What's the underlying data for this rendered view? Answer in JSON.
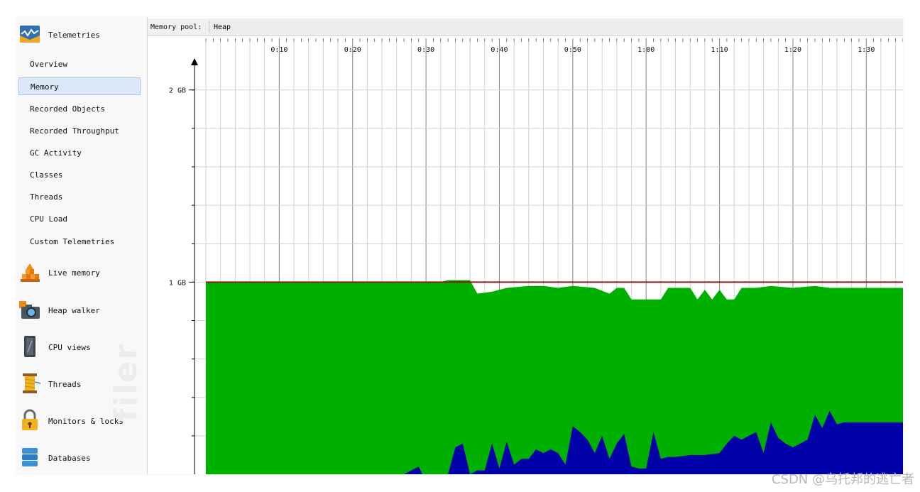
{
  "sidebar": {
    "telemetries": {
      "label": "Telemetries",
      "icon": "telemetries-icon",
      "items": [
        {
          "label": "Overview"
        },
        {
          "label": "Memory",
          "selected": true
        },
        {
          "label": "Recorded Objects"
        },
        {
          "label": "Recorded Throughput"
        },
        {
          "label": "GC Activity"
        },
        {
          "label": "Classes"
        },
        {
          "label": "Threads"
        },
        {
          "label": "CPU Load"
        },
        {
          "label": "Custom Telemetries"
        }
      ]
    },
    "sections": [
      {
        "label": "Live memory",
        "icon": "live-memory-icon"
      },
      {
        "label": "Heap walker",
        "icon": "camera-icon"
      },
      {
        "label": "CPU views",
        "icon": "cpu-views-icon"
      },
      {
        "label": "Threads",
        "icon": "thread-spool-icon"
      },
      {
        "label": "Monitors & locks",
        "icon": "lock-icon"
      },
      {
        "label": "Databases",
        "icon": "database-icon"
      }
    ],
    "watermark": "filer"
  },
  "toolbar": {
    "pool_label": "Memory pool:",
    "pool_value": "Heap"
  },
  "chart_data": {
    "type": "area",
    "x_ticks": [
      "0:10",
      "0:20",
      "0:30",
      "0:40",
      "0:50",
      "1:00",
      "1:10",
      "1:20",
      "1:30"
    ],
    "y_ticks": [
      "2 GB",
      "1 GB"
    ],
    "xlim_seconds": [
      0,
      95
    ],
    "ylim_gb": [
      0,
      2.18
    ],
    "grid": true,
    "max_line": {
      "value_gb": 1.0,
      "color": "#8b1a1a"
    },
    "series": [
      {
        "color": "#00b000",
        "x": [
          0,
          32,
          33,
          36,
          37,
          39,
          41,
          44,
          46,
          48,
          50,
          53,
          55,
          56,
          57,
          58,
          59,
          60,
          61,
          62,
          63,
          66,
          67,
          68,
          69,
          70,
          71,
          72,
          73,
          74,
          75,
          77,
          80,
          83,
          85,
          95
        ],
        "y": [
          1.0,
          1.0,
          1.01,
          1.01,
          0.94,
          0.95,
          0.97,
          0.98,
          0.98,
          0.97,
          0.98,
          0.97,
          0.94,
          0.97,
          0.97,
          0.91,
          0.91,
          0.91,
          0.91,
          0.91,
          0.97,
          0.97,
          0.91,
          0.96,
          0.91,
          0.96,
          0.91,
          0.91,
          0.97,
          0.97,
          0.97,
          0.98,
          0.97,
          0.98,
          0.97,
          0.97
        ]
      },
      {
        "color": "#0000a8",
        "x": [
          0,
          27,
          29,
          29.5,
          33,
          34,
          35,
          36,
          37,
          38,
          39,
          40,
          41,
          42,
          43,
          44,
          45,
          46,
          47,
          48,
          49,
          50,
          51,
          52,
          53,
          54,
          55,
          56,
          57,
          58,
          59,
          60,
          61,
          62,
          63,
          64,
          66,
          68,
          70,
          71,
          72,
          73,
          74,
          75,
          76,
          77,
          78,
          79,
          80,
          81,
          82,
          83,
          84,
          85,
          86,
          87,
          95
        ],
        "y": [
          0.0,
          0.0,
          0.04,
          0.0,
          0.0,
          0.14,
          0.16,
          0.0,
          0.02,
          0.02,
          0.16,
          0.03,
          0.17,
          0.05,
          0.08,
          0.08,
          0.13,
          0.11,
          0.13,
          0.11,
          0.05,
          0.25,
          0.22,
          0.18,
          0.11,
          0.2,
          0.08,
          0.16,
          0.21,
          0.04,
          0.03,
          0.03,
          0.22,
          0.08,
          0.09,
          0.09,
          0.1,
          0.1,
          0.11,
          0.16,
          0.2,
          0.18,
          0.2,
          0.22,
          0.11,
          0.27,
          0.19,
          0.16,
          0.14,
          0.16,
          0.18,
          0.31,
          0.24,
          0.33,
          0.26,
          0.27,
          0.27
        ]
      }
    ]
  },
  "footer_watermark": "CSDN @乌托邦的逃亡者"
}
